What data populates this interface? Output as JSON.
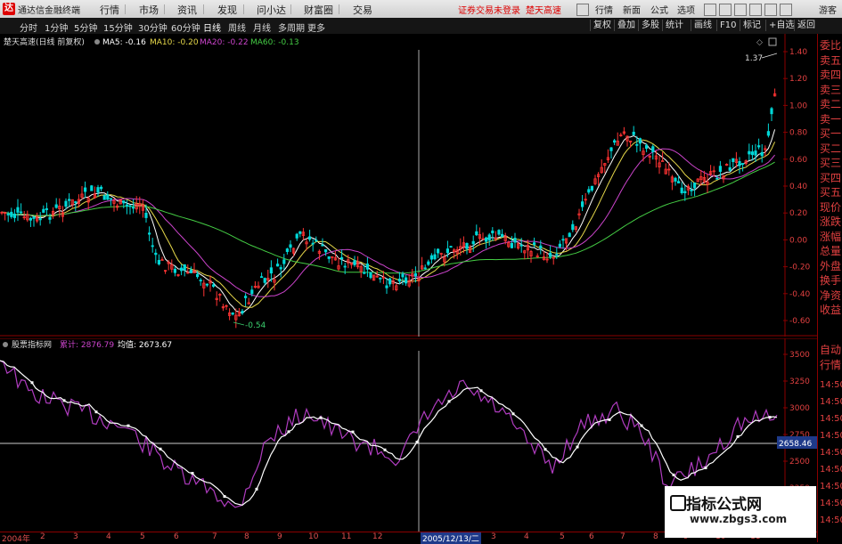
{
  "titlebar": {
    "app_title": "通达信金融终端",
    "menus": [
      "行情",
      "市场",
      "资讯",
      "发现",
      "问小达",
      "财富圈",
      "交易"
    ],
    "notice": "证券交易未登录",
    "notice2": "楚天高速",
    "right_buttons": [
      "行情",
      "新面",
      "公式",
      "选项"
    ],
    "user": "游客"
  },
  "toolbar": {
    "periods": [
      "分时",
      "1分钟",
      "5分钟",
      "15分钟",
      "30分钟",
      "60分钟",
      "日线",
      "周线",
      "月线",
      "多周期",
      "更多"
    ],
    "active_period": "日线",
    "right_tools": [
      "复权",
      "叠加",
      "多股",
      "统计",
      "画线",
      "F10",
      "标记",
      "+自选",
      "返回"
    ]
  },
  "main_chart": {
    "title": "楚天高速(日线 前复权)",
    "ma": [
      {
        "label": "MA5: -0.16",
        "color": "#ffffff"
      },
      {
        "label": "MA10: -0.20",
        "color": "#e6d84a"
      },
      {
        "label": "MA20: -0.22",
        "color": "#cc44cc"
      },
      {
        "label": "MA60: -0.13",
        "color": "#44cc44"
      }
    ],
    "y_labels": [
      "1.40",
      "1.20",
      "1.00",
      "0.80",
      "0.60",
      "0.40",
      "0.20",
      "0.00",
      "-0.20",
      "-0.40",
      "-0.60"
    ],
    "high_label": "1.37",
    "low_label": "-0.54"
  },
  "indicator": {
    "name": "股票指标网",
    "value1_label": "累计: 2876.79",
    "value2_label": "均值: 2673.67",
    "y_labels": [
      "3500",
      "3250",
      "3000",
      "2750",
      "2500",
      "2250"
    ],
    "current_value": "2658.46"
  },
  "x_axis": {
    "labels": [
      "2004年",
      "2",
      "3",
      "4",
      "5",
      "6",
      "7",
      "8",
      "9",
      "10",
      "11",
      "12",
      "2005/12/13/二",
      "3",
      "4",
      "5",
      "6",
      "7",
      "8",
      "9",
      "10",
      "11"
    ]
  },
  "side_panel": {
    "items": [
      "委比",
      "卖五",
      "卖四",
      "卖三",
      "卖二",
      "卖一",
      "买一",
      "买二",
      "买三",
      "买四",
      "买五",
      "现价",
      "涨跌",
      "涨幅",
      "总量",
      "外盘",
      "换手",
      "净资",
      "收益",
      "自动",
      "行情",
      "14:50",
      "14:50",
      "14:50",
      "14:50",
      "14:50",
      "14:50",
      "14:50",
      "14:50",
      "14:50"
    ]
  },
  "watermark": {
    "title": "指标公式网",
    "url": "www.zbgs3.com"
  },
  "colors": {
    "candle_up": "#ff3333",
    "candle_down": "#00d8d8",
    "ma5": "#ffffff",
    "ma10": "#e6d84a",
    "ma20": "#cc44cc",
    "ma60": "#44cc44",
    "axis": "#e04040"
  }
}
